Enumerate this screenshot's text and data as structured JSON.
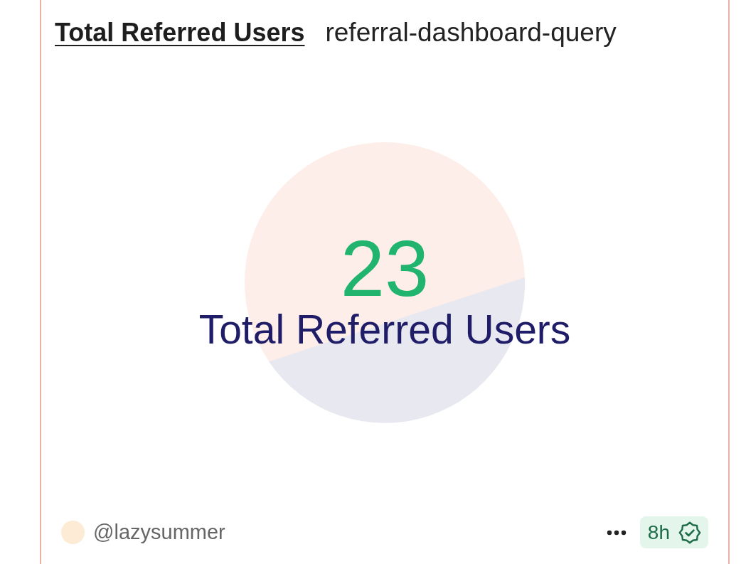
{
  "card": {
    "title": "Total Referred Users",
    "query_name": "referral-dashboard-query",
    "metric": {
      "value": "23",
      "label": "Total Referred Users"
    },
    "author": {
      "handle": "@lazysummer"
    },
    "age": {
      "text": "8h",
      "verified": true
    }
  }
}
